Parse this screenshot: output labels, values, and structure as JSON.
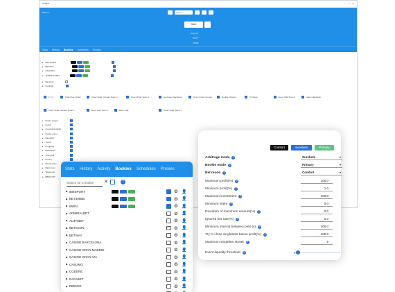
{
  "background_window": {
    "title": "surEbet",
    "menu_label": "Bproud",
    "search_placeholder": "Type it",
    "start_label": "Start",
    "status_lines": [
      "Stopped",
      "PROT",
      "FTRM"
    ],
    "tabs": [
      "Stats",
      "History",
      "Bookies",
      "Schedules",
      "Proxies"
    ],
    "active_tab": "Bookies",
    "bookies": [
      "BETSWIFE",
      "BETWAY",
      "CASUMO",
      "ADMIRALTBET",
      "Baseball",
      "Football"
    ],
    "options_row1": [
      "1 X 2",
      "Total Over Under",
      "Over Under Corners Team 2",
      "Over Under Team 1",
      "European Handicap",
      "Over Under Corners",
      "Double Chance",
      "To Score",
      "Even Odd Team 2",
      "Asian Handicap"
    ],
    "options_row2": [
      "Over Under Corners Team 1",
      "Even Odd Team 1",
      "Even Odd",
      "Over Under Team 2"
    ],
    "sports": [
      "Rugby league",
      "Futsal",
      "Americanfootball",
      "Rugby union",
      "Handball",
      "Tennis",
      "Pingpong",
      "Basketball",
      "Volleyball",
      "Hockey",
      "Beachvolley",
      "Badminton",
      "Waterpolo",
      "BBSPORT"
    ]
  },
  "bookies_panel": {
    "tabs": [
      "Stats",
      "History",
      "Activity",
      "Bookies",
      "Schedules",
      "Proxies"
    ],
    "active_tab": "Bookies",
    "search_placeholder": "Search for a bookie",
    "clear_symbol": "✕",
    "help_symbol": "?",
    "rows": [
      {
        "name": "888SPORT",
        "chips": true,
        "checked": true
      },
      {
        "name": "BET365BB",
        "chips": true,
        "checked": true
      },
      {
        "name": "BWIN",
        "chips": true,
        "checked": true
      },
      {
        "name": "ADMIRALBET",
        "chips": false,
        "checked": false
      },
      {
        "name": "ALIFABET",
        "chips": false,
        "checked": false
      },
      {
        "name": "BETSSON",
        "chips": false,
        "checked": false
      },
      {
        "name": "BETWAY",
        "chips": false,
        "checked": false
      },
      {
        "name": "CASINO BARCELONA",
        "chips": false,
        "checked": false
      },
      {
        "name": "CASINO GRAN MADRID",
        "chips": false,
        "checked": false
      },
      {
        "name": "CASINO GRAN VIA",
        "chips": false,
        "checked": false
      },
      {
        "name": "CASUMO",
        "chips": false,
        "checked": false
      },
      {
        "name": "CODERE",
        "chips": false,
        "checked": false
      },
      {
        "name": "DAFABET",
        "chips": false,
        "checked": false
      },
      {
        "name": "EBINGO",
        "chips": false,
        "checked": false
      },
      {
        "name": "EFBET",
        "chips": false,
        "checked": false
      }
    ],
    "chip_colors": [
      "#111111",
      "#2b6fd6",
      "#4caf50"
    ]
  },
  "settings": {
    "layout_buttons": [
      {
        "label": "Comfort",
        "bg": "#111111",
        "fg": "#ffffff"
      },
      {
        "label": "Surebets",
        "bg": "#2b6fd6",
        "fg": "#ffffff"
      },
      {
        "label": "Primary",
        "bg": "#5cc48a",
        "fg": "#ffffff"
      }
    ],
    "arbitrage_mode": {
      "label": "Arbitrage mode",
      "value": "Surebets"
    },
    "bookie_mode": {
      "label": "Bookie mode",
      "value": "Primary"
    },
    "bet_mode": {
      "label": "Bet mode",
      "value": "Comfort"
    },
    "fields": [
      {
        "label": "Maximum profit(%)",
        "value": "100.0"
      },
      {
        "label": "Minimum profit(%)",
        "value": "1.0"
      },
      {
        "label": "Maximum investment",
        "value": "100.0"
      },
      {
        "label": "Minimum stake",
        "value": "0.0"
      },
      {
        "label": "Deviation of maximum amount(%)",
        "value": "0.0"
      },
      {
        "label": "Ignored bet rate(%)",
        "value": "0.0"
      },
      {
        "label": "Minimum interval between bets (s)",
        "value": "300.0"
      },
      {
        "label": "Try to close singlebets below profit(%)",
        "value": "-100.0"
      },
      {
        "label": "Maximum singlebet streak",
        "value": "5"
      }
    ],
    "liquidity": {
      "label": "Event liquidity threshold",
      "value": "0"
    },
    "help_symbol": "?",
    "dropdown_symbol": "▾"
  }
}
